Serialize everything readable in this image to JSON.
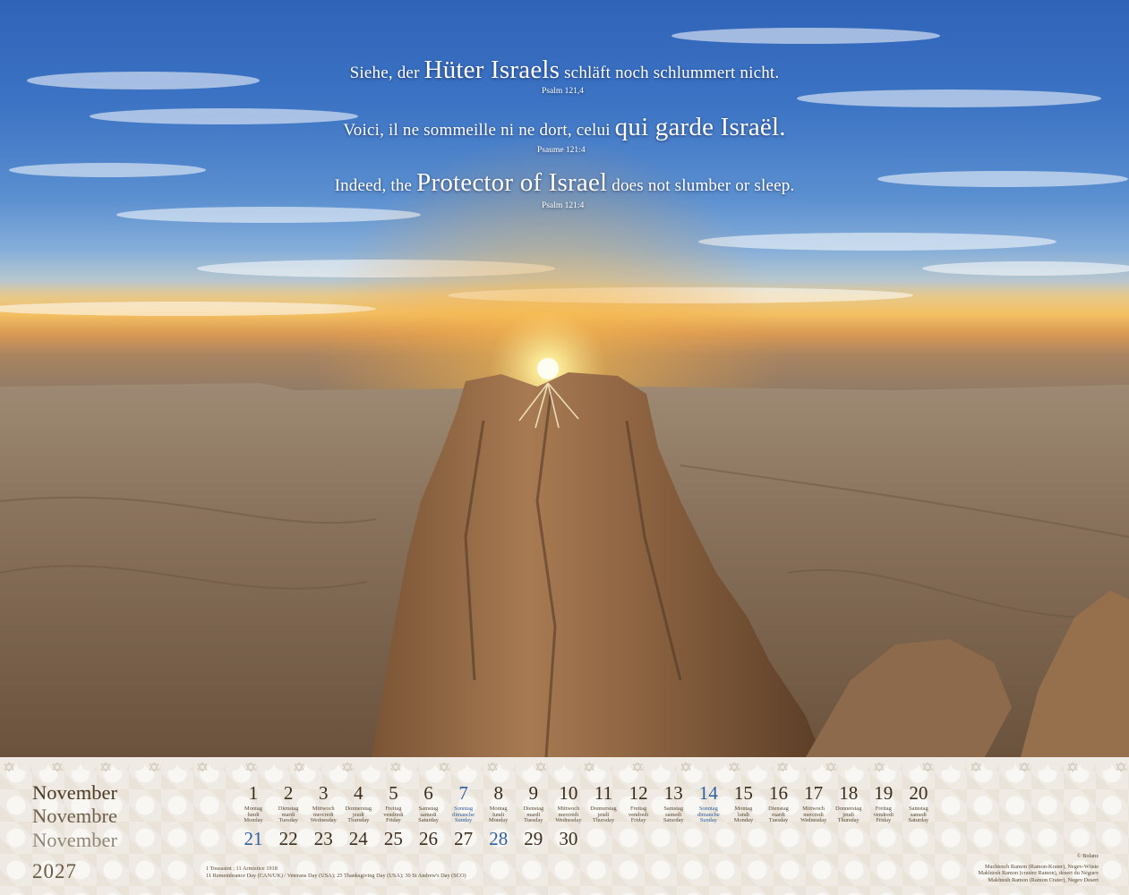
{
  "verses": [
    {
      "pre": "Siehe, der ",
      "big": "Hüter Israels",
      "post": " schläft noch schlummert nicht.",
      "ref": "Psalm 121,4"
    },
    {
      "pre": "Voici, il ne sommeille ni ne dort, celui ",
      "big": "qui garde Israël.",
      "post": "",
      "ref": "Psaume 121:4"
    },
    {
      "pre": "Indeed, the ",
      "big": "Protector of Israel",
      "post": " does not slumber or sleep.",
      "ref": "Psalm 121:4"
    }
  ],
  "calendar": {
    "month_de": "November",
    "month_fr": "Novembre",
    "month_en": "November",
    "year": "2027",
    "weekday_labels": {
      "sun": [
        "Sonntag",
        "dimanche",
        "Sunday"
      ],
      "mon": [
        "Montag",
        "lundi",
        "Monday"
      ],
      "tue": [
        "Dienstag",
        "mardi",
        "Tuesday"
      ],
      "wed": [
        "Mittwoch",
        "mercredi",
        "Wednesday"
      ],
      "thu": [
        "Donnerstag",
        "jeudi",
        "Thursday"
      ],
      "fri": [
        "Freitag",
        "vendredi",
        "Friday"
      ],
      "sat": [
        "Samstag",
        "samedi",
        "Saturday"
      ]
    },
    "row1": [
      "1",
      "2",
      "3",
      "4",
      "5",
      "6",
      "7",
      "8",
      "9",
      "10",
      "11",
      "12",
      "13",
      "14",
      "15",
      "16",
      "17",
      "18",
      "19",
      "20"
    ],
    "row1_weekdays": [
      "mon",
      "tue",
      "wed",
      "thu",
      "fri",
      "sat",
      "sun",
      "mon",
      "tue",
      "wed",
      "thu",
      "fri",
      "sat",
      "sun",
      "mon",
      "tue",
      "wed",
      "thu",
      "fri",
      "sat"
    ],
    "row2": [
      "21",
      "22",
      "23",
      "24",
      "25",
      "26",
      "27",
      "28",
      "29",
      "30"
    ],
    "row2_weekdays": [
      "sun",
      "mon",
      "tue",
      "wed",
      "thu",
      "fri",
      "sat",
      "sun",
      "mon",
      "tue"
    ],
    "holidays": [
      "1 Toussaint ; 11 Armistice 1918",
      "11 Remembrance Day (CAN/UK) / Veterans Day (USA); 25 Thanksgiving Day (USA); 30 St Andrew's Day (SCO)"
    ],
    "copyright": "© Bolanz",
    "captions": [
      "Machtesch Ramon (Ramon-Krater), Negev-Wüste",
      "Makhtesh Ramon (cratère Ramon), désert du Néguev",
      "Makhtesh Ramon (Ramon Crater), Negev Desert"
    ],
    "colors": {
      "sunday": "#2f5f9e",
      "text": "#3b2d1d"
    }
  }
}
